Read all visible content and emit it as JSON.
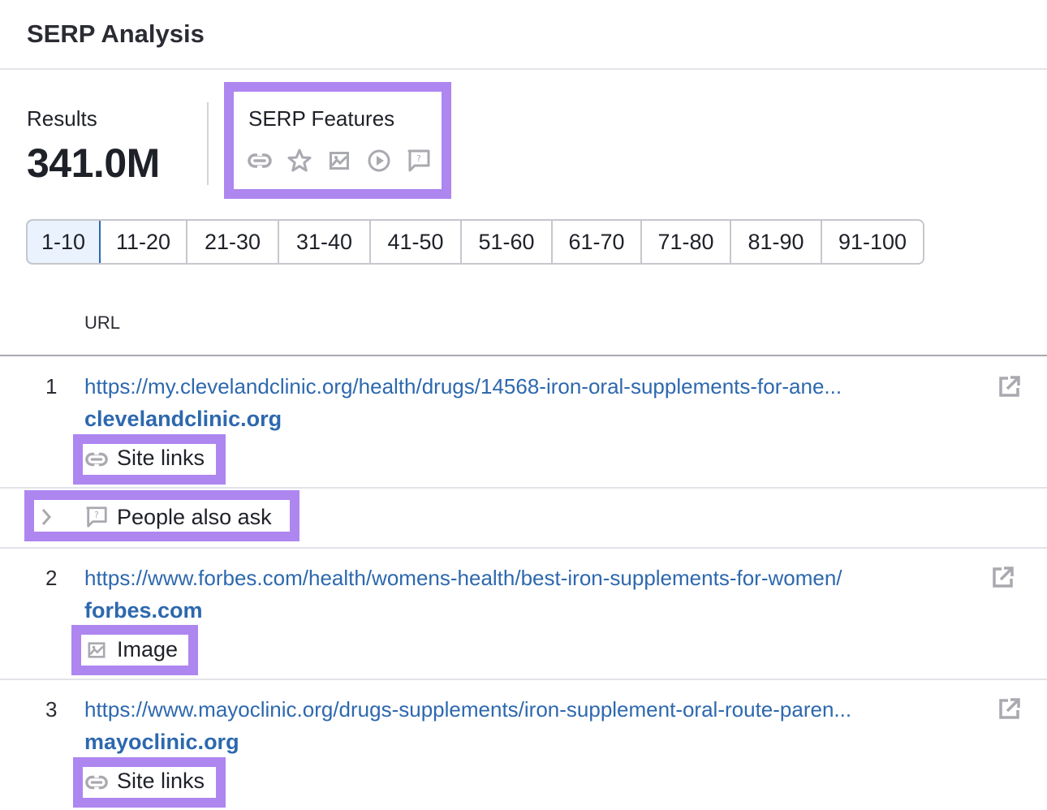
{
  "header": {
    "title": "SERP Analysis"
  },
  "summary": {
    "results_label": "Results",
    "results_value": "341.0M",
    "serp_features_label": "SERP Features",
    "serp_feature_icons": [
      "link-icon",
      "star-icon",
      "image-icon",
      "play-icon",
      "question-bubble-icon"
    ]
  },
  "pagination": {
    "pages": [
      "1-10",
      "11-20",
      "21-30",
      "31-40",
      "41-50",
      "51-60",
      "61-70",
      "71-80",
      "81-90",
      "91-100"
    ],
    "active": "1-10"
  },
  "table": {
    "column_header": "URL",
    "rows": [
      {
        "position": "1",
        "url": "https://my.clevelandclinic.org/health/drugs/14568-iron-oral-supplements-for-ane...",
        "domain": "clevelandclinic.org",
        "feature": {
          "icon": "link-icon",
          "label": "Site links"
        }
      },
      {
        "type": "serp-feature-row",
        "icon": "question-bubble-icon",
        "label": "People also ask"
      },
      {
        "position": "2",
        "url": "https://www.forbes.com/health/womens-health/best-iron-supplements-for-women/",
        "domain": "forbes.com",
        "feature": {
          "icon": "image-icon",
          "label": "Image"
        }
      },
      {
        "position": "3",
        "url": "https://www.mayoclinic.org/drugs-supplements/iron-supplement-oral-route-paren...",
        "domain": "mayoclinic.org",
        "feature": {
          "icon": "link-icon",
          "label": "Site links"
        }
      }
    ]
  },
  "colors": {
    "highlight": "#ae86f0",
    "link": "#2d68ae",
    "active_page_bg": "#eaf2fd",
    "active_page_border": "#2e69b3",
    "icon_gray": "#a9a9b0"
  }
}
